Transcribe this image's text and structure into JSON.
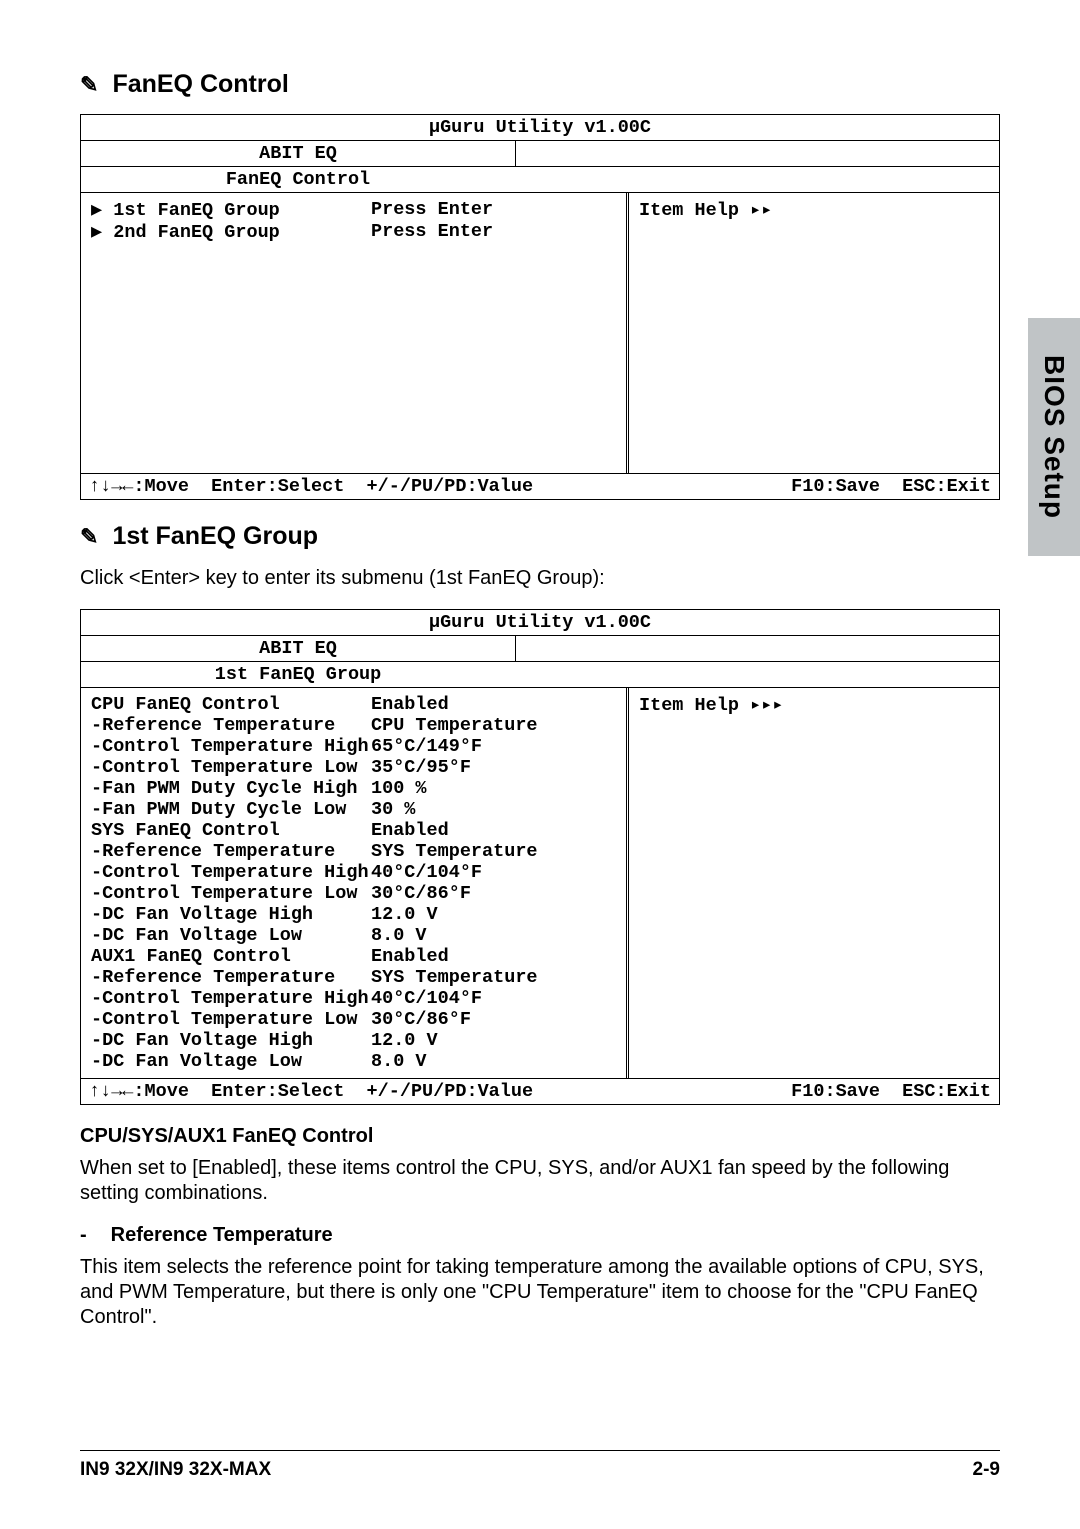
{
  "sideTab": "BIOS Setup",
  "heading1": "FanEQ Control",
  "box1": {
    "title": "µGuru Utility v1.00C",
    "tab": "ABIT EQ",
    "subtitle": "FanEQ Control",
    "rows": [
      {
        "label": "▶ 1st FanEQ Group",
        "value": "Press Enter"
      },
      {
        "label": "▶ 2nd FanEQ Group",
        "value": "Press Enter"
      }
    ],
    "help": "Item Help ▸▸",
    "footerLeft": "↑↓→←:Move  Enter:Select  +/-/PU/PD:Value",
    "footerRight": "F10:Save  ESC:Exit"
  },
  "heading2": "1st FanEQ Group",
  "para1": "Click <Enter> key to enter its submenu (1st FanEQ Group):",
  "box2": {
    "title": "µGuru Utility v1.00C",
    "tab": "ABIT EQ",
    "subtitle": "1st FanEQ Group",
    "rows": [
      {
        "label": "CPU FanEQ Control",
        "value": "Enabled"
      },
      {
        "label": "-Reference Temperature",
        "value": "CPU Temperature"
      },
      {
        "label": "-Control Temperature High",
        "value": "65°C/149°F"
      },
      {
        "label": "-Control Temperature Low",
        "value": "35°C/95°F"
      },
      {
        "label": "-Fan PWM Duty Cycle High",
        "value": "100 %"
      },
      {
        "label": "-Fan PWM Duty Cycle Low",
        "value": "30 %"
      },
      {
        "label": "SYS FanEQ Control",
        "value": "Enabled"
      },
      {
        "label": "-Reference Temperature",
        "value": "SYS Temperature"
      },
      {
        "label": "-Control Temperature High",
        "value": "40°C/104°F"
      },
      {
        "label": "-Control Temperature Low",
        "value": "30°C/86°F"
      },
      {
        "label": "-DC Fan Voltage High",
        "value": "12.0 V"
      },
      {
        "label": "-DC Fan Voltage Low",
        "value": "8.0 V"
      },
      {
        "label": "AUX1 FanEQ Control",
        "value": "Enabled"
      },
      {
        "label": "-Reference Temperature",
        "value": "SYS Temperature"
      },
      {
        "label": "-Control Temperature High",
        "value": "40°C/104°F"
      },
      {
        "label": "-Control Temperature Low",
        "value": "30°C/86°F"
      },
      {
        "label": "-DC Fan Voltage High",
        "value": "12.0 V"
      },
      {
        "label": "-DC Fan Voltage Low",
        "value": "8.0 V"
      }
    ],
    "help": "Item Help ▸▸▸",
    "footerLeft": "↑↓→←:Move  Enter:Select  +/-/PU/PD:Value",
    "footerRight": "F10:Save  ESC:Exit"
  },
  "sub1": "CPU/SYS/AUX1 FanEQ Control",
  "para2": "When set to [Enabled], these items control the CPU, SYS, and/or AUX1 fan speed by the following setting combinations.",
  "sub2": "Reference Temperature",
  "para3": "This item selects the reference point for taking temperature among the available options of CPU, SYS, and PWM Temperature, but there is only one \"CPU Temperature\" item to choose for the \"CPU FanEQ Control\".",
  "footerLeft": "IN9 32X/IN9 32X-MAX",
  "footerRight": "2-9"
}
